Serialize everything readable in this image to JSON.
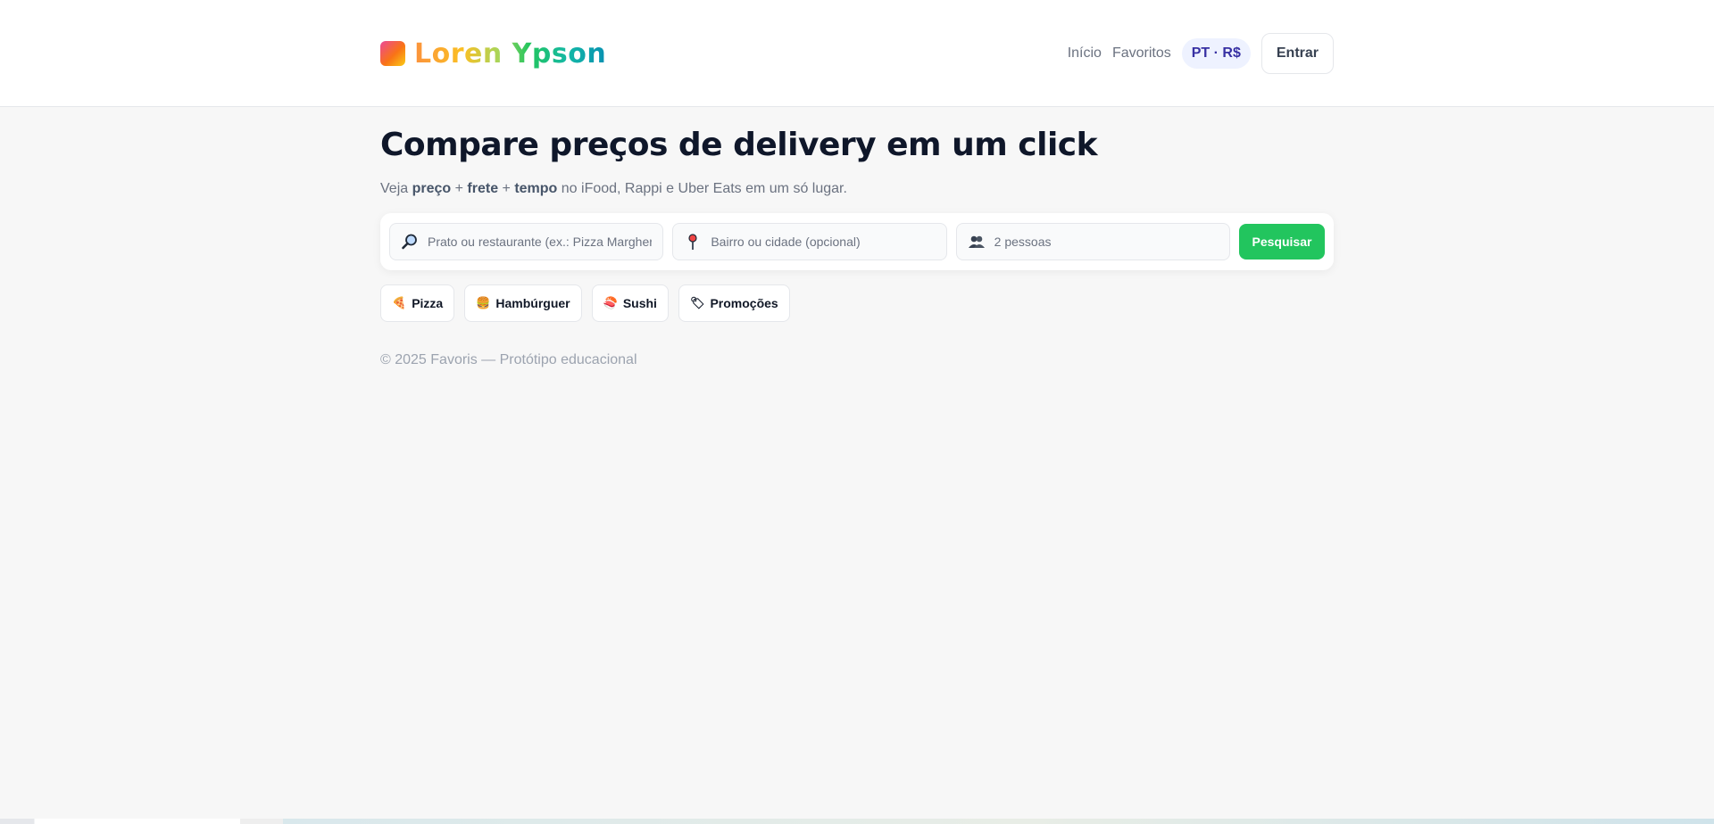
{
  "header": {
    "brand": "Loren Ypson",
    "nav": [
      {
        "label": "Início"
      },
      {
        "label": "Favoritos"
      }
    ],
    "lang": "PT · R$",
    "login": "Entrar"
  },
  "hero": {
    "title": "Compare preços de delivery em um click",
    "sub": {
      "t1": "Veja ",
      "b1": "preço",
      "t2": " + ",
      "b2": "frete",
      "t3": " + ",
      "b3": "tempo",
      "t4": " no iFood, Rappi e Uber Eats em um só lugar."
    }
  },
  "search": {
    "dish_placeholder": "Prato ou restaurante (ex.: Pizza Margherita)",
    "location_placeholder": "Bairro ou cidade (opcional)",
    "people_placeholder": "2 pessoas",
    "button": "Pesquisar",
    "icons": [
      "magnifier-icon",
      "pin-icon",
      "people-icon"
    ]
  },
  "chips": [
    {
      "label": "Pizza",
      "icon": "pizza-icon",
      "glyph": "🍕"
    },
    {
      "label": "Hambúrguer",
      "icon": "burger-icon",
      "glyph": "🍔"
    },
    {
      "label": "Sushi",
      "icon": "sushi-icon",
      "glyph": "🍣"
    },
    {
      "label": "Promoções",
      "icon": "promo-icon",
      "glyph": "🏷"
    }
  ],
  "footer": "© 2025 Favoris — Protótipo educacional",
  "colors": {
    "accent": "#22c55e",
    "lang_bg": "#eef2ff",
    "lang_text": "#3730a3"
  }
}
